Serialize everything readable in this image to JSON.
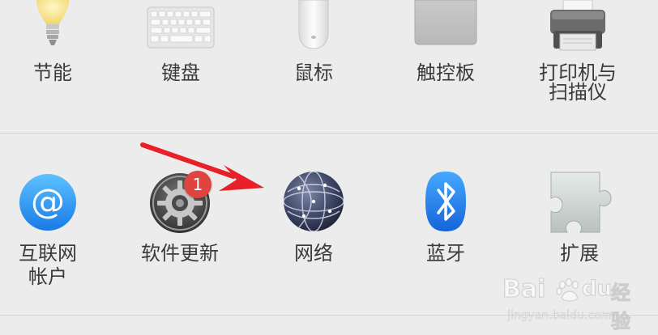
{
  "hardware_row": {
    "items": [
      {
        "label": "节能",
        "icon": "lightbulb-icon"
      },
      {
        "label": "键盘",
        "icon": "keyboard-icon"
      },
      {
        "label": "鼠标",
        "icon": "mouse-icon"
      },
      {
        "label": "触控板",
        "icon": "trackpad-icon"
      },
      {
        "label_line1": "打印机与",
        "label_line2": "扫描仪",
        "icon": "printer-icon"
      }
    ]
  },
  "internet_row": {
    "items": [
      {
        "label_line1": "互联网",
        "label_line2": "帐户",
        "icon": "at-sign-icon"
      },
      {
        "label": "软件更新",
        "icon": "gear-icon",
        "badge": "1"
      },
      {
        "label": "网络",
        "icon": "globe-icon"
      },
      {
        "label": "蓝牙",
        "icon": "bluetooth-icon"
      },
      {
        "label": "扩展",
        "icon": "puzzle-icon"
      }
    ]
  },
  "annotation": {
    "arrow_color": "#e8202a",
    "target": "网络"
  },
  "watermark": {
    "brand": "Bai",
    "brand_suffix": "du",
    "service": "经验",
    "url": "jingyan.baidu.com"
  },
  "colors": {
    "background": "#ececec",
    "divider": "#d3d3d3",
    "badge": "#e0443e",
    "label": "#3a3a3a"
  }
}
